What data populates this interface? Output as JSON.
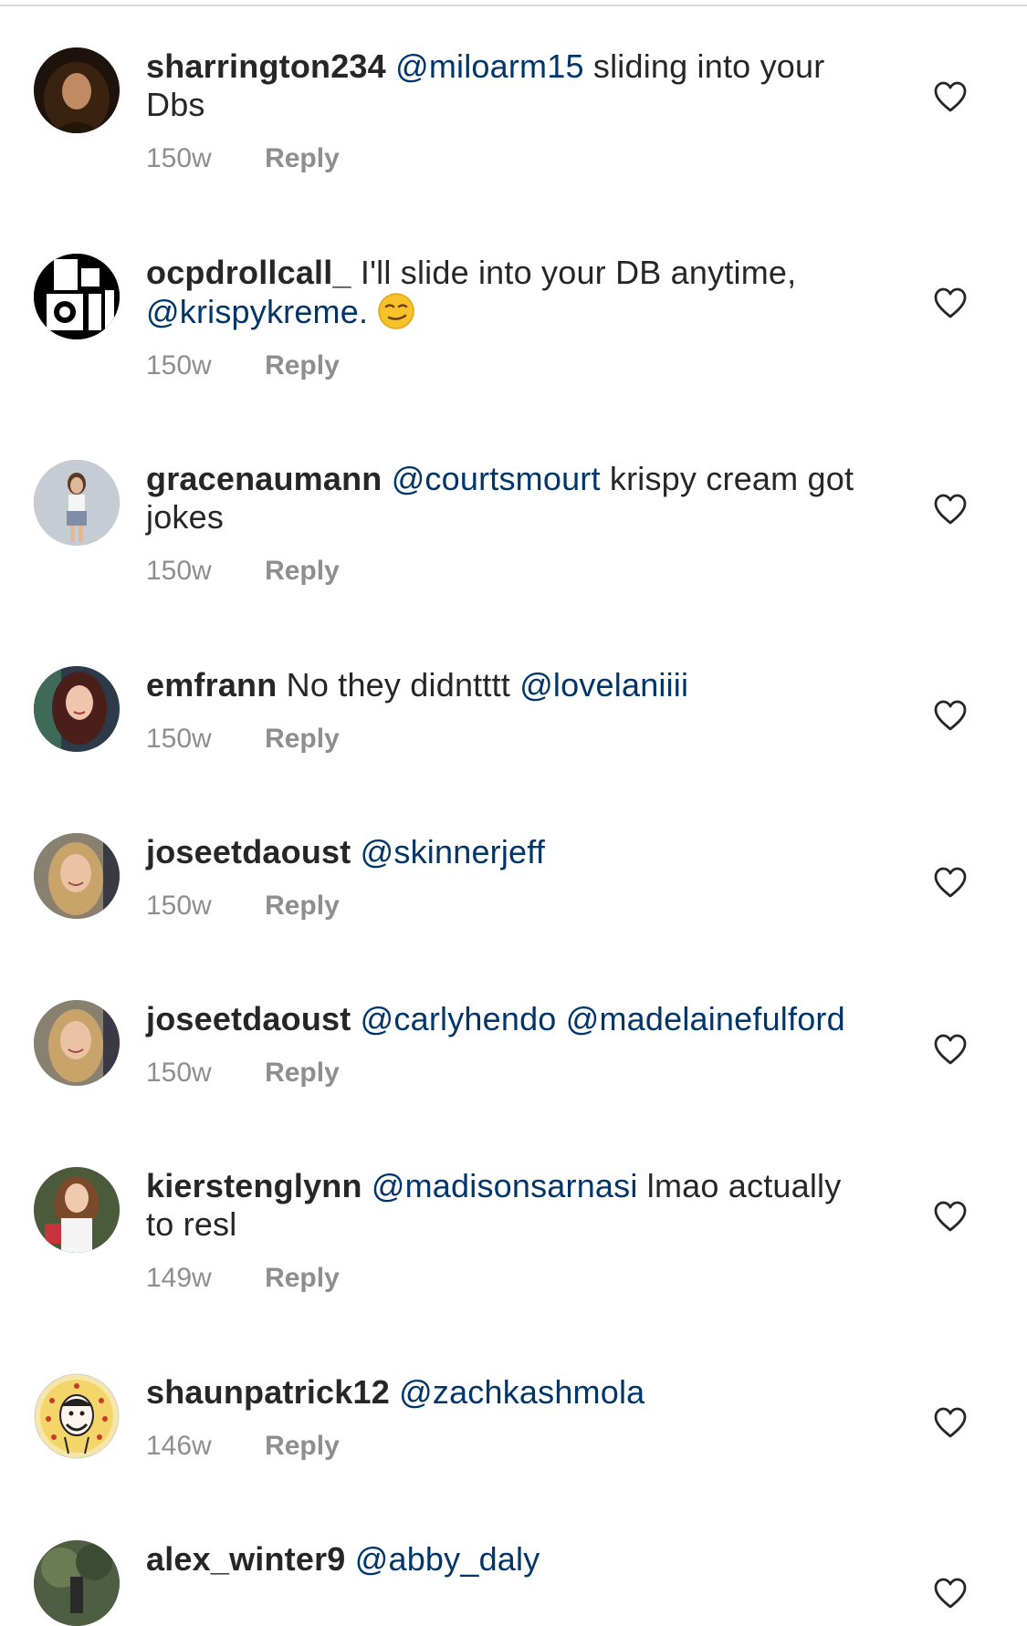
{
  "comments": [
    {
      "username": "sharrington234",
      "mentions_before": "@miloarm15",
      "text": "sliding into your Dbs",
      "time": "150w",
      "reply": "Reply"
    },
    {
      "username": "ocpdrollcall_",
      "text": "I'll slide into your DB anytime,",
      "mention_after": "@krispykreme.",
      "emoji": "smirking-face",
      "time": "150w",
      "reply": "Reply"
    },
    {
      "username": "gracenaumann",
      "mentions_before": "@courtsmourt",
      "text": "krispy cream got jokes",
      "time": "150w",
      "reply": "Reply"
    },
    {
      "username": "emfrann",
      "text": "No they didntttt",
      "mention_after": "@lovelaniiii",
      "time": "150w",
      "reply": "Reply"
    },
    {
      "username": "joseetdaoust",
      "mentions_before": "@skinnerjeff",
      "time": "150w",
      "reply": "Reply"
    },
    {
      "username": "joseetdaoust",
      "mentions_before": "@carlyhendo @madelainefulford",
      "time": "150w",
      "reply": "Reply"
    },
    {
      "username": "kierstenglynn",
      "mentions_before": "@madisonsarnasi",
      "text": "lmao actually to resl",
      "time": "149w",
      "reply": "Reply"
    },
    {
      "username": "shaunpatrick12",
      "mentions_before": "@zachkashmola",
      "time": "146w",
      "reply": "Reply"
    },
    {
      "username": "alex_winter9",
      "mentions_before": "@abby_daly"
    }
  ],
  "icons": {
    "like": "heart-outline-icon"
  },
  "colors": {
    "text": "#262626",
    "mention": "#003569",
    "meta": "#8e8e8e",
    "divider": "#dbdbdb",
    "background": "#ffffff"
  }
}
